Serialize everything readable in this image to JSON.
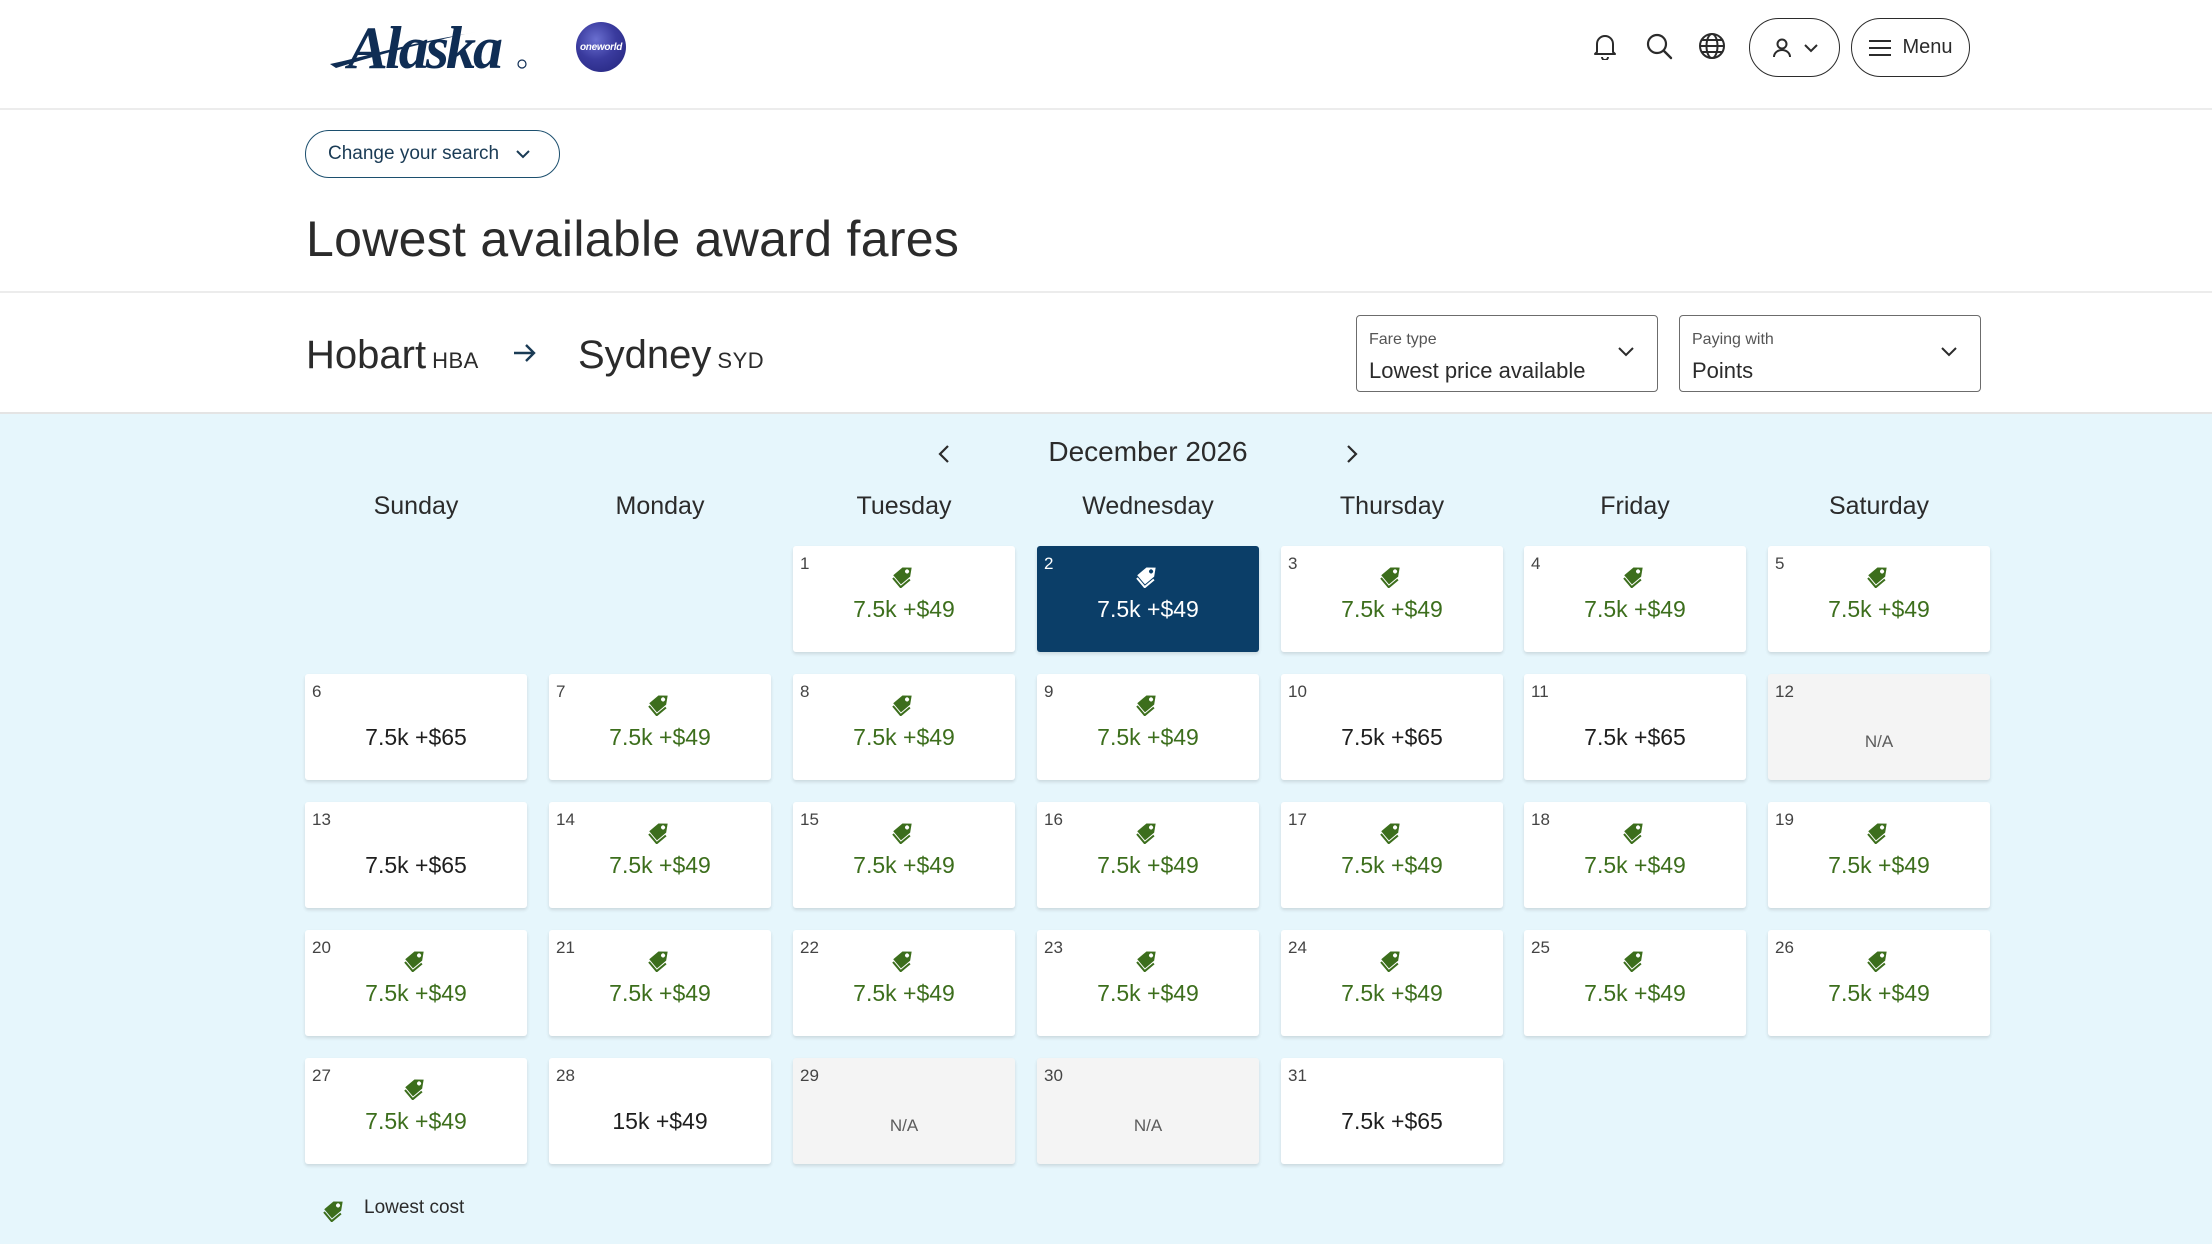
{
  "brand": {
    "name": "Alaska",
    "alliance": "oneworld"
  },
  "header": {
    "menu_label": "Menu"
  },
  "search": {
    "change_label": "Change your search"
  },
  "page": {
    "title": "Lowest available award fares"
  },
  "route": {
    "origin_city": "Hobart",
    "origin_code": "HBA",
    "destination_city": "Sydney",
    "destination_code": "SYD"
  },
  "filters": {
    "fare_type": {
      "label": "Fare type",
      "value": "Lowest price available"
    },
    "paying_with": {
      "label": "Paying with",
      "value": "Points"
    }
  },
  "calendar": {
    "month": "December 2026",
    "weekdays": [
      "Sunday",
      "Monday",
      "Tuesday",
      "Wednesday",
      "Thursday",
      "Friday",
      "Saturday"
    ],
    "days": [
      {
        "day": "1",
        "price": "7.5k +$49",
        "lowest": true
      },
      {
        "day": "2",
        "price": "7.5k +$49",
        "lowest": true,
        "selected": true
      },
      {
        "day": "3",
        "price": "7.5k +$49",
        "lowest": true
      },
      {
        "day": "4",
        "price": "7.5k +$49",
        "lowest": true
      },
      {
        "day": "5",
        "price": "7.5k +$49",
        "lowest": true
      },
      {
        "day": "6",
        "price": "7.5k +$65",
        "lowest": false
      },
      {
        "day": "7",
        "price": "7.5k +$49",
        "lowest": true
      },
      {
        "day": "8",
        "price": "7.5k +$49",
        "lowest": true
      },
      {
        "day": "9",
        "price": "7.5k +$49",
        "lowest": true
      },
      {
        "day": "10",
        "price": "7.5k +$65",
        "lowest": false
      },
      {
        "day": "11",
        "price": "7.5k +$65",
        "lowest": false
      },
      {
        "day": "12",
        "price": "N/A",
        "na": true
      },
      {
        "day": "13",
        "price": "7.5k +$65",
        "lowest": false
      },
      {
        "day": "14",
        "price": "7.5k +$49",
        "lowest": true
      },
      {
        "day": "15",
        "price": "7.5k +$49",
        "lowest": true
      },
      {
        "day": "16",
        "price": "7.5k +$49",
        "lowest": true
      },
      {
        "day": "17",
        "price": "7.5k +$49",
        "lowest": true
      },
      {
        "day": "18",
        "price": "7.5k +$49",
        "lowest": true
      },
      {
        "day": "19",
        "price": "7.5k +$49",
        "lowest": true
      },
      {
        "day": "20",
        "price": "7.5k +$49",
        "lowest": true
      },
      {
        "day": "21",
        "price": "7.5k +$49",
        "lowest": true
      },
      {
        "day": "22",
        "price": "7.5k +$49",
        "lowest": true
      },
      {
        "day": "23",
        "price": "7.5k +$49",
        "lowest": true
      },
      {
        "day": "24",
        "price": "7.5k +$49",
        "lowest": true
      },
      {
        "day": "25",
        "price": "7.5k +$49",
        "lowest": true
      },
      {
        "day": "26",
        "price": "7.5k +$49",
        "lowest": true
      },
      {
        "day": "27",
        "price": "7.5k +$49",
        "lowest": true
      },
      {
        "day": "28",
        "price": "15k +$49",
        "lowest": false
      },
      {
        "day": "29",
        "price": "N/A",
        "na": true
      },
      {
        "day": "30",
        "price": "N/A",
        "na": true
      },
      {
        "day": "31",
        "price": "7.5k +$65",
        "lowest": false
      }
    ]
  },
  "legend": {
    "label": "Lowest cost",
    "icon": "price-tag-icon"
  },
  "colors": {
    "primary": "#0b3e68",
    "lowest": "#3c6e1c",
    "background": "#e6f6fc"
  }
}
